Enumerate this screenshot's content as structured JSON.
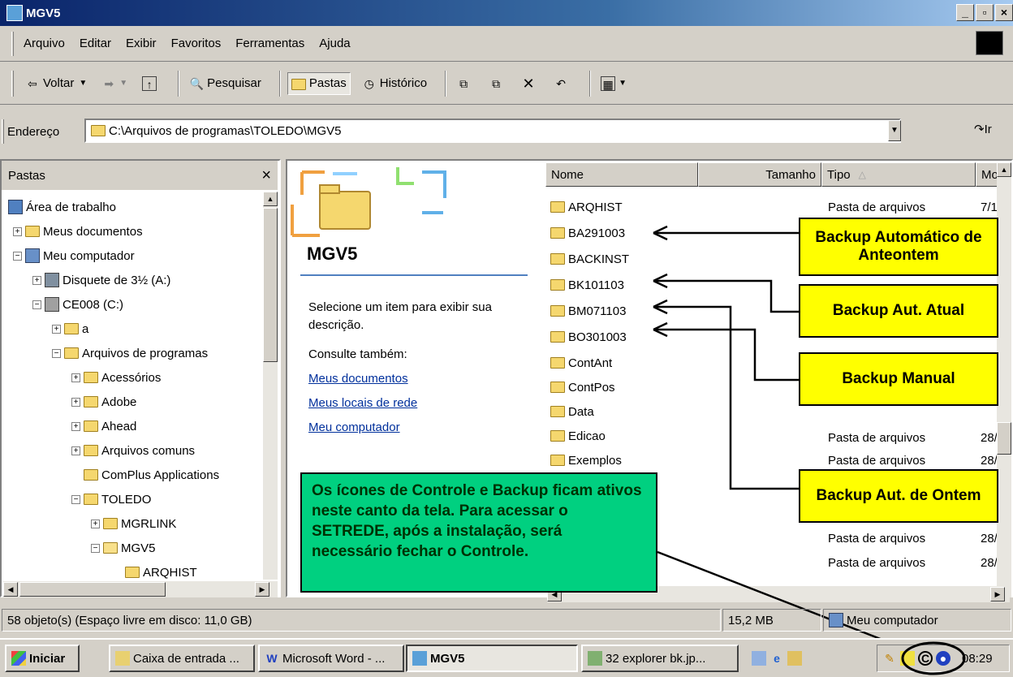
{
  "window": {
    "title": "MGV5",
    "buttons": [
      "_",
      "▫",
      "×"
    ]
  },
  "menu": [
    "Arquivo",
    "Editar",
    "Exibir",
    "Favoritos",
    "Ferramentas",
    "Ajuda"
  ],
  "toolbar": {
    "back": "Voltar",
    "search": "Pesquisar",
    "folders": "Pastas",
    "history": "Histórico"
  },
  "address": {
    "label": "Endereço",
    "value": "C:\\Arquivos de programas\\TOLEDO\\MGV5",
    "go": "Ir"
  },
  "folders_pane": {
    "title": "Pastas",
    "close": "×",
    "tree": [
      "Área de trabalho",
      "Meus documentos",
      "Meu computador",
      "Disquete de 3½ (A:)",
      "CE008 (C:)",
      "a",
      "Arquivos de programas",
      "Acessórios",
      "Adobe",
      "Ahead",
      "Arquivos comuns",
      "ComPlus Applications",
      "TOLEDO",
      "MGRLINK",
      "MGV5",
      "ARQHIST"
    ]
  },
  "webview": {
    "title": "MGV5",
    "desc": "Selecione um item para exibir sua descrição.",
    "see_also": "Consulte também:",
    "links": [
      "Meus documentos",
      "Meus locais de rede",
      "Meu computador"
    ]
  },
  "columns": [
    "Nome",
    "Tamanho",
    "Tipo",
    "Mo"
  ],
  "files": [
    "ARQHIST",
    "BA291003",
    "BACKINST",
    "BK101103",
    "BM071103",
    "BO301003",
    "ContAnt",
    "ContPos",
    "Data",
    "Edicao",
    "Exemplos"
  ],
  "types": {
    "row1": "Pasta de arquivos",
    "row1_date": "7/1",
    "rows": [
      "Pasta de arquivos",
      "Pasta de arquivos",
      "Pasta de arquivos",
      "Pasta de arquivos"
    ],
    "dates": [
      "28/",
      "28/",
      "28/",
      "28/"
    ]
  },
  "callouts": {
    "c1": "Backup Automático de Anteontem",
    "c2": "Backup Aut. Atual",
    "c3": "Backup Manual",
    "c4": "Backup Aut. de Ontem",
    "green": "Os ícones de Controle e Backup ficam ativos neste canto da tela. Para acessar o SETREDE, após a instalação, será necessário fechar o Controle."
  },
  "status": {
    "objects": "58 objeto(s) (Espaço livre em disco: 11,0 GB)",
    "size": "15,2 MB",
    "location": "Meu computador"
  },
  "taskbar": {
    "start": "Iniciar",
    "tasks": [
      "Caixa de entrada ...",
      "Microsoft Word - ...",
      "MGV5",
      "32 explorer bk.jp..."
    ],
    "clock": "08:29"
  },
  "colors": {
    "callout": "#ffff00",
    "green": "#00d080",
    "title_start": "#0a246a"
  }
}
